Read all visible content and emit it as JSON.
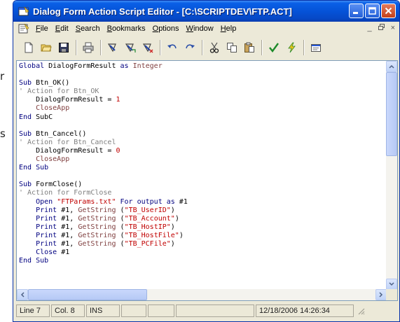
{
  "background_text": [
    "r",
    "s"
  ],
  "window": {
    "title": "Dialog Form Action Script Editor - [C:\\SCRIPTDEV\\FTP.ACT]"
  },
  "menu": [
    {
      "u": "F",
      "rest": "ile"
    },
    {
      "u": "E",
      "rest": "dit"
    },
    {
      "u": "S",
      "rest": "earch"
    },
    {
      "u": "B",
      "rest": "ookmarks"
    },
    {
      "u": "O",
      "rest": "ptions"
    },
    {
      "u": "W",
      "rest": "indow"
    },
    {
      "u": "H",
      "rest": "elp"
    }
  ],
  "mdi_controls": [
    "_",
    "×"
  ],
  "toolbar_icons": [
    "new-file-icon",
    "open-folder-icon",
    "save-icon",
    "print-icon",
    "bookmark-toggle-icon",
    "bookmark-next-icon",
    "bookmark-clear-icon",
    "undo-icon",
    "redo-icon",
    "cut-icon",
    "copy-icon",
    "paste-icon",
    "check-syntax-icon",
    "run-icon",
    "properties-icon"
  ],
  "code_lines": [
    [
      {
        "t": "Global ",
        "c": "kw"
      },
      {
        "t": "DialogFormResult ",
        "c": "tx"
      },
      {
        "t": "as ",
        "c": "kw"
      },
      {
        "t": "Integer",
        "c": "ty"
      }
    ],
    [],
    [
      {
        "t": "Sub ",
        "c": "kw"
      },
      {
        "t": "Btn_OK()",
        "c": "tx"
      }
    ],
    [
      {
        "t": "' Action for Btn_OK",
        "c": "cm"
      }
    ],
    [
      {
        "t": "    DialogFormResult = ",
        "c": "tx"
      },
      {
        "t": "1",
        "c": "st"
      }
    ],
    [
      {
        "t": "    CloseApp",
        "c": "ty"
      }
    ],
    [
      {
        "t": "End ",
        "c": "kw"
      },
      {
        "t": "SubC",
        "c": "tx"
      }
    ],
    [],
    [
      {
        "t": "Sub ",
        "c": "kw"
      },
      {
        "t": "Btn_Cancel()",
        "c": "tx"
      }
    ],
    [
      {
        "t": "' Action for Btn_Cancel",
        "c": "cm"
      }
    ],
    [
      {
        "t": "    DialogFormResult = ",
        "c": "tx"
      },
      {
        "t": "0",
        "c": "st"
      }
    ],
    [
      {
        "t": "    CloseApp",
        "c": "ty"
      }
    ],
    [
      {
        "t": "End Sub",
        "c": "kw"
      }
    ],
    [],
    [
      {
        "t": "Sub ",
        "c": "kw"
      },
      {
        "t": "FormClose()",
        "c": "tx"
      }
    ],
    [
      {
        "t": "' Action for FormClose",
        "c": "cm"
      }
    ],
    [
      {
        "t": "    Open ",
        "c": "kw"
      },
      {
        "t": "\"FTParams.txt\"",
        "c": "st"
      },
      {
        "t": " For output as ",
        "c": "kw"
      },
      {
        "t": "#1",
        "c": "tx"
      }
    ],
    [
      {
        "t": "    Print ",
        "c": "kw"
      },
      {
        "t": "#1, ",
        "c": "tx"
      },
      {
        "t": "GetString ",
        "c": "ty"
      },
      {
        "t": "(",
        "c": "tx"
      },
      {
        "t": "\"TB_UserID\"",
        "c": "st"
      },
      {
        "t": ")",
        "c": "tx"
      }
    ],
    [
      {
        "t": "    Print ",
        "c": "kw"
      },
      {
        "t": "#1, ",
        "c": "tx"
      },
      {
        "t": "GetString ",
        "c": "ty"
      },
      {
        "t": "(",
        "c": "tx"
      },
      {
        "t": "\"TB_Account\"",
        "c": "st"
      },
      {
        "t": ")",
        "c": "tx"
      }
    ],
    [
      {
        "t": "    Print ",
        "c": "kw"
      },
      {
        "t": "#1, ",
        "c": "tx"
      },
      {
        "t": "GetString ",
        "c": "ty"
      },
      {
        "t": "(",
        "c": "tx"
      },
      {
        "t": "\"TB_HostIP\"",
        "c": "st"
      },
      {
        "t": ")",
        "c": "tx"
      }
    ],
    [
      {
        "t": "    Print ",
        "c": "kw"
      },
      {
        "t": "#1, ",
        "c": "tx"
      },
      {
        "t": "GetString ",
        "c": "ty"
      },
      {
        "t": "(",
        "c": "tx"
      },
      {
        "t": "\"TB_HostFile\"",
        "c": "st"
      },
      {
        "t": ")",
        "c": "tx"
      }
    ],
    [
      {
        "t": "    Print ",
        "c": "kw"
      },
      {
        "t": "#1, ",
        "c": "tx"
      },
      {
        "t": "GetString ",
        "c": "ty"
      },
      {
        "t": "(",
        "c": "tx"
      },
      {
        "t": "\"TB_PCFile\"",
        "c": "st"
      },
      {
        "t": ")",
        "c": "tx"
      }
    ],
    [
      {
        "t": "    Close ",
        "c": "kw"
      },
      {
        "t": "#1",
        "c": "tx"
      }
    ],
    [
      {
        "t": "End Sub",
        "c": "kw"
      }
    ]
  ],
  "status": {
    "line": "Line 7",
    "col": "Col. 8",
    "mode": "INS",
    "datetime": "12/18/2006 14:26:34"
  }
}
